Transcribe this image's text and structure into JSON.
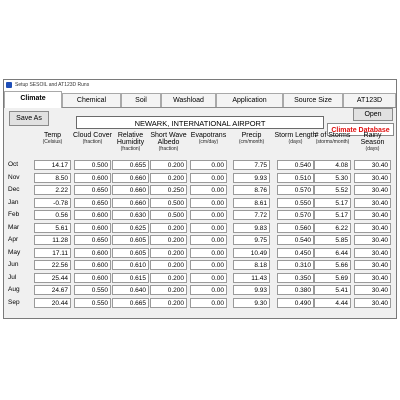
{
  "window": {
    "title": "Setup SESOIL and AT123D Runs"
  },
  "tabs": [
    {
      "label": "Climate"
    },
    {
      "label": "Chemical"
    },
    {
      "label": "Soil"
    },
    {
      "label": "Washload"
    },
    {
      "label": "Application"
    },
    {
      "label": "Source Size"
    },
    {
      "label": "AT123D"
    }
  ],
  "toolbar": {
    "save_as_label": "Save As",
    "open_label": "Open",
    "climate_db_label": "Climate Database"
  },
  "station": {
    "name": "NEWARK, INTERNATIONAL AIRPORT"
  },
  "columns": [
    {
      "label": "Temp",
      "unit": "(Celsius)"
    },
    {
      "label": "Cloud Cover",
      "unit": "(fraction)"
    },
    {
      "label": "Relative Humidity",
      "unit": "(fraction)"
    },
    {
      "label": "Short Wave Albedo",
      "unit": "(fraction)"
    },
    {
      "label": "Evapotrans",
      "unit": "(cm/day)"
    },
    {
      "label": "Precip",
      "unit": "(cm/month)"
    },
    {
      "label": "Storm Length",
      "unit": "(days)"
    },
    {
      "label": "# of Storms",
      "unit": "(storms/month)"
    },
    {
      "label": "Rainy Season",
      "unit": "(days)"
    }
  ],
  "rows": [
    {
      "month": "Oct",
      "values": [
        "14.17",
        "0.500",
        "0.655",
        "0.200",
        "0.00",
        "7.75",
        "0.540",
        "4.08",
        "30.40"
      ]
    },
    {
      "month": "Nov",
      "values": [
        "8.50",
        "0.600",
        "0.660",
        "0.200",
        "0.00",
        "9.93",
        "0.510",
        "5.30",
        "30.40"
      ]
    },
    {
      "month": "Dec",
      "values": [
        "2.22",
        "0.650",
        "0.660",
        "0.250",
        "0.00",
        "8.76",
        "0.570",
        "5.52",
        "30.40"
      ]
    },
    {
      "month": "Jan",
      "values": [
        "-0.78",
        "0.650",
        "0.660",
        "0.500",
        "0.00",
        "8.61",
        "0.550",
        "5.17",
        "30.40"
      ]
    },
    {
      "month": "Feb",
      "values": [
        "0.56",
        "0.600",
        "0.630",
        "0.500",
        "0.00",
        "7.72",
        "0.570",
        "5.17",
        "30.40"
      ]
    },
    {
      "month": "Mar",
      "values": [
        "5.61",
        "0.600",
        "0.625",
        "0.200",
        "0.00",
        "9.83",
        "0.560",
        "6.22",
        "30.40"
      ]
    },
    {
      "month": "Apr",
      "values": [
        "11.28",
        "0.650",
        "0.605",
        "0.200",
        "0.00",
        "9.75",
        "0.540",
        "5.85",
        "30.40"
      ]
    },
    {
      "month": "May",
      "values": [
        "17.11",
        "0.600",
        "0.605",
        "0.200",
        "0.00",
        "10.49",
        "0.450",
        "6.44",
        "30.40"
      ]
    },
    {
      "month": "Jun",
      "values": [
        "22.56",
        "0.600",
        "0.610",
        "0.200",
        "0.00",
        "8.18",
        "0.310",
        "5.66",
        "30.40"
      ]
    },
    {
      "month": "Jul",
      "values": [
        "25.44",
        "0.600",
        "0.615",
        "0.200",
        "0.00",
        "11.43",
        "0.350",
        "5.69",
        "30.40"
      ]
    },
    {
      "month": "Aug",
      "values": [
        "24.67",
        "0.550",
        "0.640",
        "0.200",
        "0.00",
        "9.93",
        "0.380",
        "5.41",
        "30.40"
      ]
    },
    {
      "month": "Sep",
      "values": [
        "20.44",
        "0.550",
        "0.665",
        "0.200",
        "0.00",
        "9.30",
        "0.490",
        "4.44",
        "30.40"
      ]
    }
  ]
}
